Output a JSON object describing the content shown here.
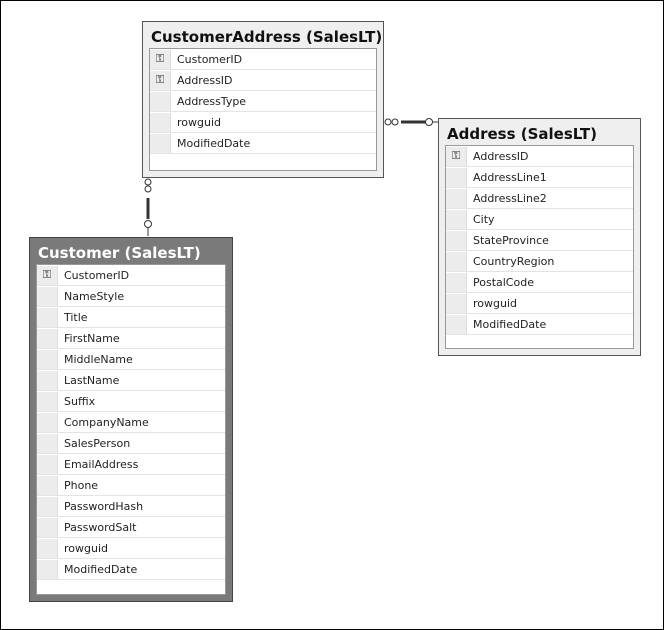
{
  "tables": [
    {
      "id": "customer-address",
      "title": "CustomerAddress (SalesLT)",
      "selected": false,
      "columns": [
        {
          "name": "CustomerID",
          "key": true
        },
        {
          "name": "AddressID",
          "key": true
        },
        {
          "name": "AddressType",
          "key": false
        },
        {
          "name": "rowguid",
          "key": false
        },
        {
          "name": "ModifiedDate",
          "key": false
        }
      ]
    },
    {
      "id": "address",
      "title": "Address (SalesLT)",
      "selected": false,
      "columns": [
        {
          "name": "AddressID",
          "key": true
        },
        {
          "name": "AddressLine1",
          "key": false
        },
        {
          "name": "AddressLine2",
          "key": false
        },
        {
          "name": "City",
          "key": false
        },
        {
          "name": "StateProvince",
          "key": false
        },
        {
          "name": "CountryRegion",
          "key": false
        },
        {
          "name": "PostalCode",
          "key": false
        },
        {
          "name": "rowguid",
          "key": false
        },
        {
          "name": "ModifiedDate",
          "key": false
        }
      ]
    },
    {
      "id": "customer",
      "title": "Customer (SalesLT)",
      "selected": true,
      "columns": [
        {
          "name": "CustomerID",
          "key": true
        },
        {
          "name": "NameStyle",
          "key": false
        },
        {
          "name": "Title",
          "key": false
        },
        {
          "name": "FirstName",
          "key": false
        },
        {
          "name": "MiddleName",
          "key": false
        },
        {
          "name": "LastName",
          "key": false
        },
        {
          "name": "Suffix",
          "key": false
        },
        {
          "name": "CompanyName",
          "key": false
        },
        {
          "name": "SalesPerson",
          "key": false
        },
        {
          "name": "EmailAddress",
          "key": false
        },
        {
          "name": "Phone",
          "key": false
        },
        {
          "name": "PasswordHash",
          "key": false
        },
        {
          "name": "PasswordSalt",
          "key": false
        },
        {
          "name": "rowguid",
          "key": false
        },
        {
          "name": "ModifiedDate",
          "key": false
        }
      ]
    }
  ],
  "relationships": [
    {
      "from": "customer-address",
      "to": "address",
      "from_end": "many",
      "to_end": "one"
    },
    {
      "from": "customer-address",
      "to": "customer",
      "from_end": "many",
      "to_end": "one"
    }
  ],
  "icons": {
    "primary_key": "key-icon"
  }
}
